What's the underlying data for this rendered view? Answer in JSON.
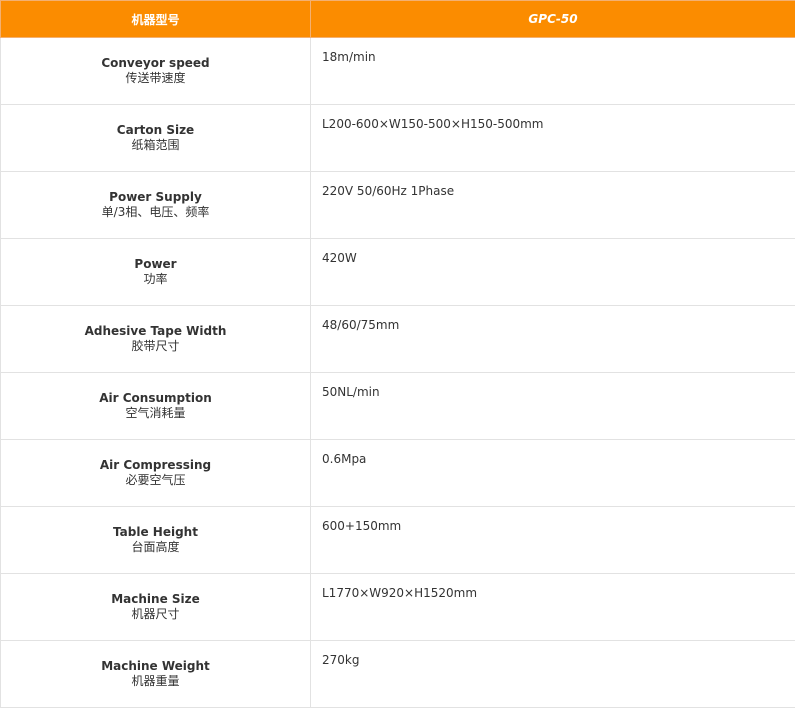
{
  "header": {
    "col1": "机器型号",
    "col2": "GPC-50"
  },
  "rows": [
    {
      "en": "Conveyor speed",
      "zh": "传送带速度",
      "value": "18m/min"
    },
    {
      "en": "Carton Size",
      "zh": "纸箱范围",
      "value": "L200-600×W150-500×H150-500mm"
    },
    {
      "en": "Power Supply",
      "zh": "单/3相、电压、频率",
      "value": "220V 50/60Hz 1Phase"
    },
    {
      "en": "Power",
      "zh": "功率",
      "value": "420W"
    },
    {
      "en": "Adhesive Tape Width",
      "zh": "胶带尺寸",
      "value": "48/60/75mm"
    },
    {
      "en": "Air Consumption",
      "zh": "空气消耗量",
      "value": "50NL/min"
    },
    {
      "en": "Air Compressing",
      "zh": "必要空气压",
      "value": "0.6Mpa"
    },
    {
      "en": "Table Height",
      "zh": "台面高度",
      "value": "600+150mm"
    },
    {
      "en": "Machine Size",
      "zh": "机器尺寸",
      "value": "L1770×W920×H1520mm"
    },
    {
      "en": "Machine Weight",
      "zh": "机器重量",
      "value": "270kg"
    }
  ],
  "colors": {
    "header_bg": "#fb8c00",
    "header_text": "#ffffff",
    "border": "#e2e2e2",
    "text": "#333333"
  }
}
